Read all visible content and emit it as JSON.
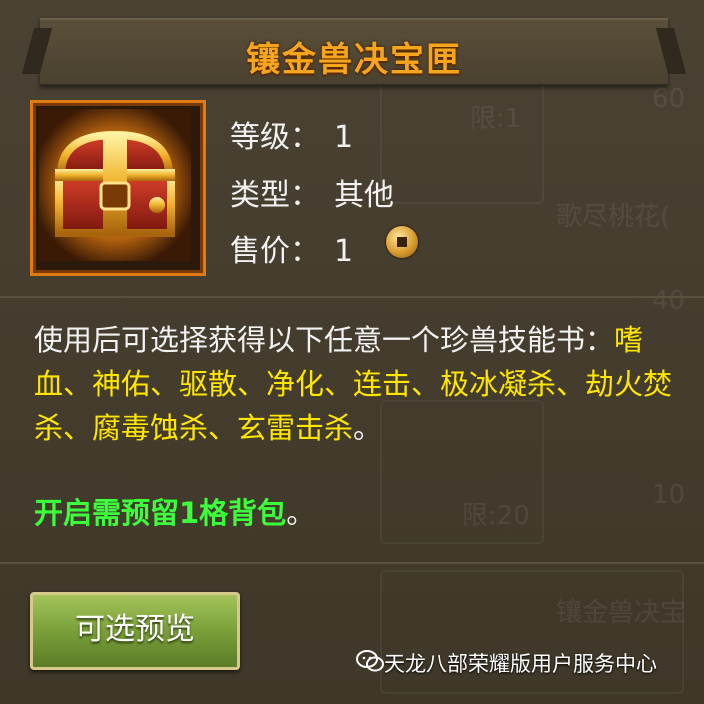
{
  "title": "镶金兽决宝匣",
  "item": {
    "icon": "treasure-chest-icon",
    "attributes": [
      {
        "label": "等级：",
        "value": "1"
      },
      {
        "label": "类型：",
        "value": "其他"
      },
      {
        "label": "售价：",
        "value": "1"
      }
    ],
    "price_icon": "copper-coin-icon"
  },
  "description": {
    "line_prefix": "使用后可选择获得以下任意一个珍兽技能书：",
    "skills_text": "嗜血、神佑、驱散、净化、连击、极冰凝杀、劫火焚杀、腐毒蚀杀、玄雷击杀",
    "line_suffix": "。"
  },
  "notice": {
    "highlight": "开启需预留1格背包",
    "tail": "。"
  },
  "button": {
    "preview_label": "可选预览"
  },
  "watermark": {
    "text": "天龙八部荣耀版用户服务中心",
    "icon": "wechat-icon"
  },
  "background_text": {
    "limit1": "限:1",
    "limit20": "限:20",
    "name1": "歌尽桃花(",
    "name2": "镶金兽决宝",
    "n60": "60",
    "n40": "40",
    "n10": "10"
  },
  "colors": {
    "title": "#f7a51d",
    "skills": "#ffe600",
    "notice": "#3cff3c",
    "frame": "#e07a12"
  }
}
